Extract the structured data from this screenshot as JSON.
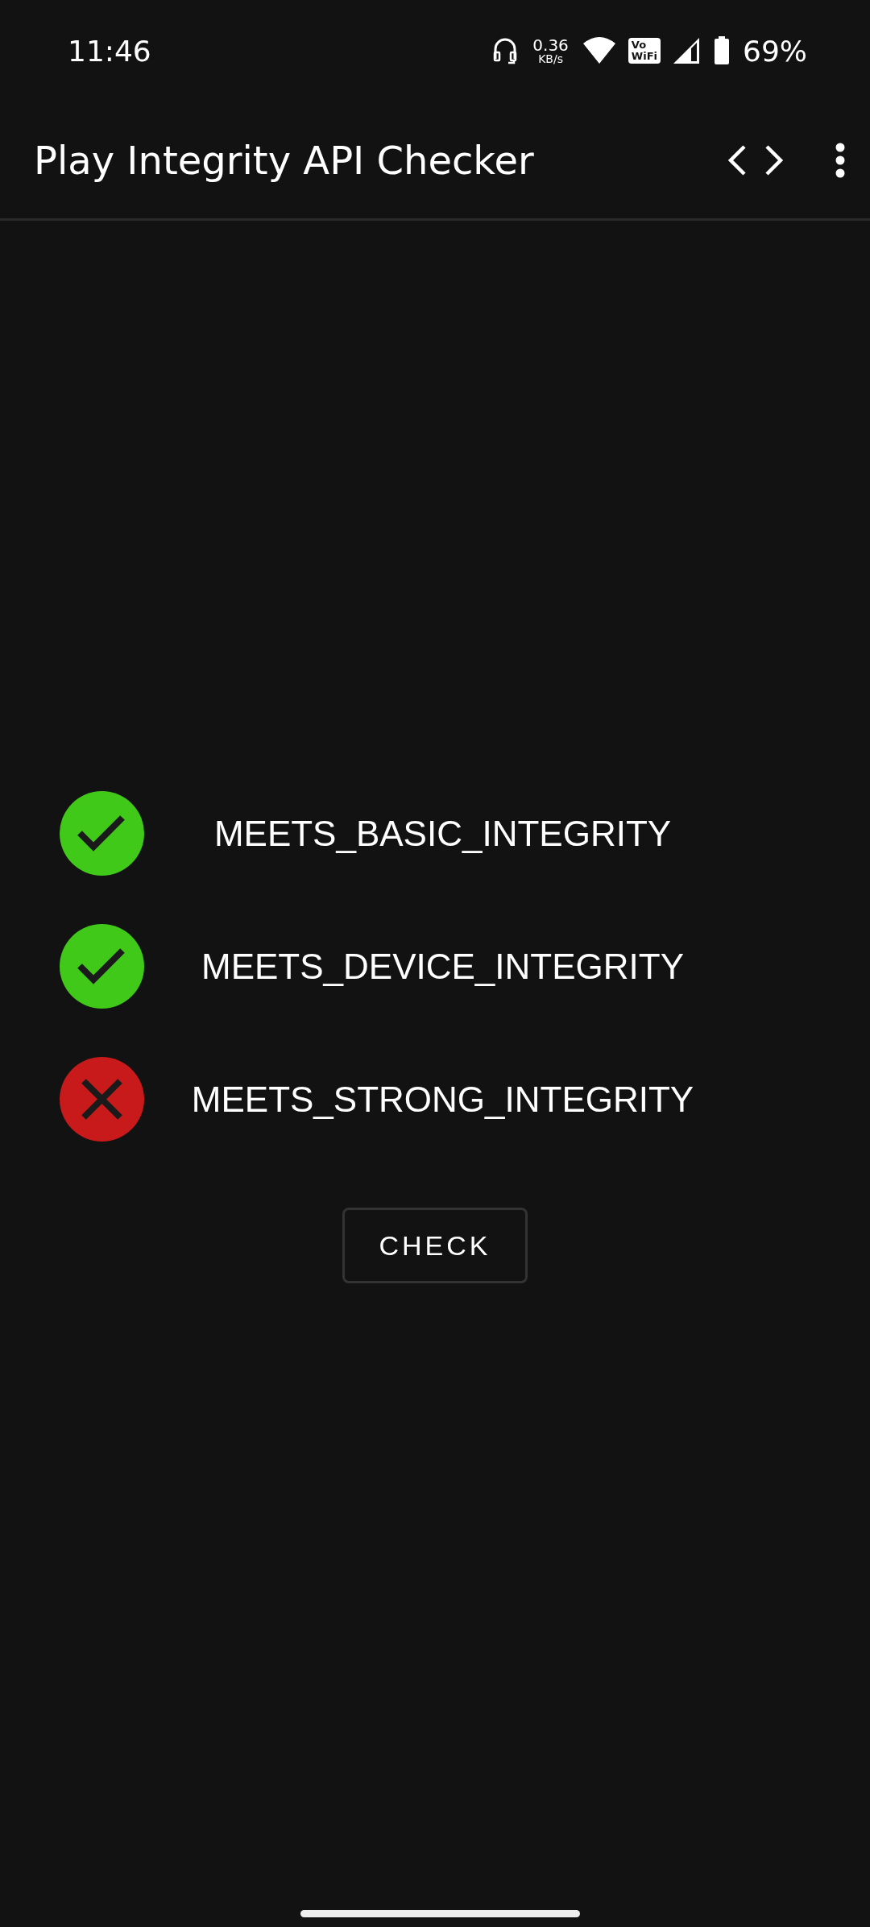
{
  "status_bar": {
    "time": "11:46",
    "speed_value": "0.36",
    "speed_unit": "KB/s",
    "vowifi": [
      "Vo",
      "WiFi"
    ],
    "battery": "69%"
  },
  "app_bar": {
    "title": "Play Integrity API Checker"
  },
  "results": [
    {
      "label": "MEETS_BASIC_INTEGRITY",
      "passed": true
    },
    {
      "label": "MEETS_DEVICE_INTEGRITY",
      "passed": true
    },
    {
      "label": "MEETS_STRONG_INTEGRITY",
      "passed": false
    }
  ],
  "button": "CHECK"
}
